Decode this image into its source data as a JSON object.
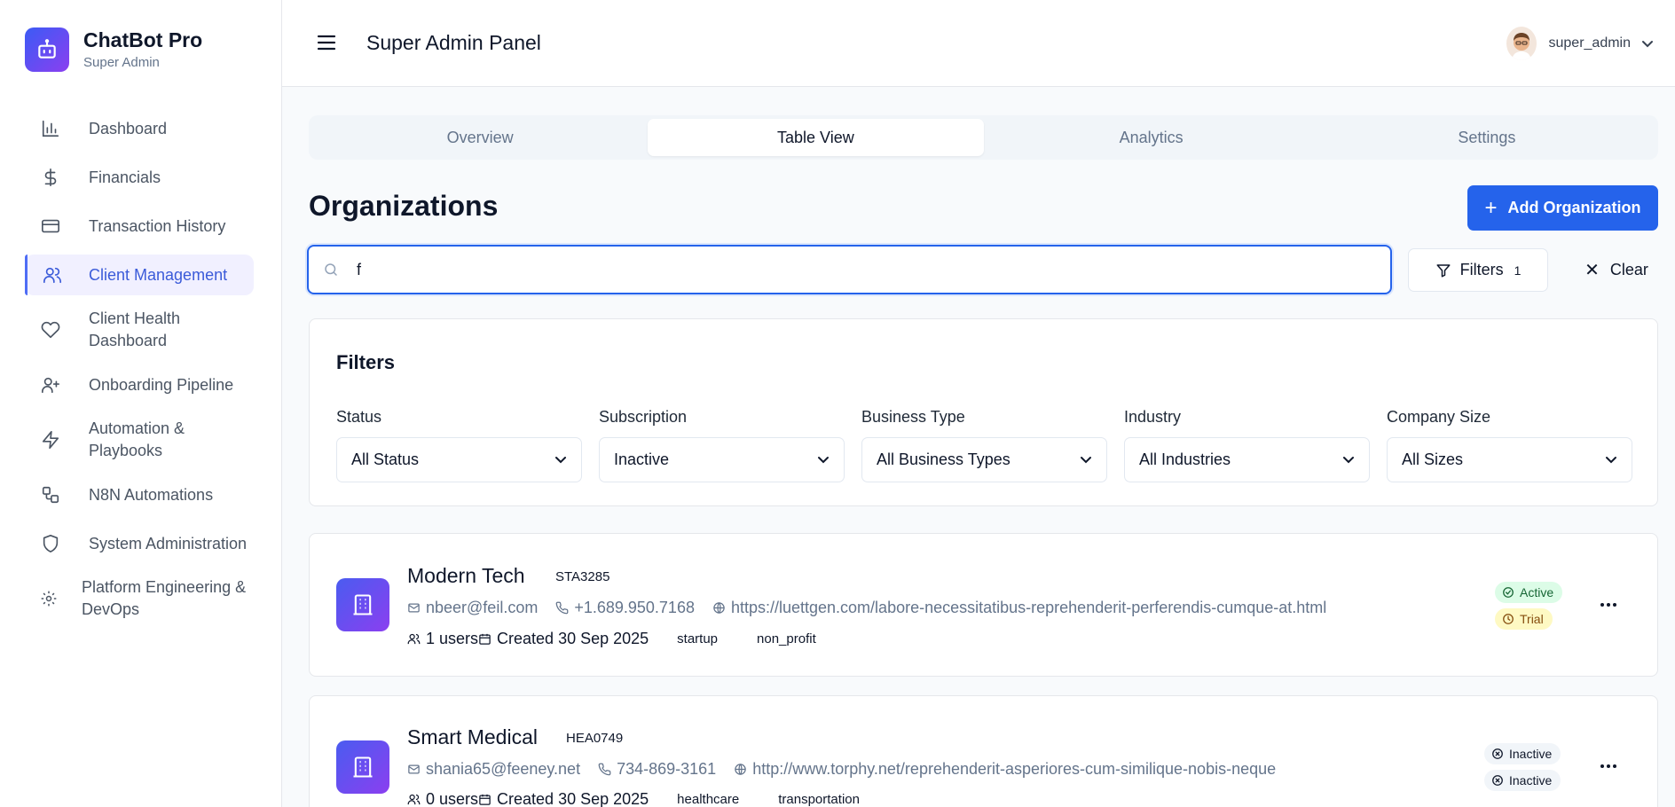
{
  "brand": {
    "name": "ChatBot Pro",
    "subtitle": "Super Admin"
  },
  "sidebar": {
    "items": [
      {
        "label": "Dashboard",
        "icon": "bar-chart-icon"
      },
      {
        "label": "Financials",
        "icon": "dollar-icon"
      },
      {
        "label": "Transaction History",
        "icon": "credit-card-icon"
      },
      {
        "label": "Client Management",
        "icon": "users-icon",
        "active": true
      },
      {
        "label": "Client Health Dashboard",
        "icon": "heart-icon"
      },
      {
        "label": "Onboarding Pipeline",
        "icon": "user-plus-icon"
      },
      {
        "label": "Automation & Playbooks",
        "icon": "lightning-icon"
      },
      {
        "label": "N8N Automations",
        "icon": "workflow-icon"
      },
      {
        "label": "System Administration",
        "icon": "shield-icon"
      },
      {
        "label": "Platform Engineering & DevOps",
        "icon": "gear-icon"
      }
    ]
  },
  "header": {
    "title": "Super Admin Panel",
    "username": "super_admin"
  },
  "tabs": [
    {
      "label": "Overview"
    },
    {
      "label": "Table View",
      "active": true
    },
    {
      "label": "Analytics"
    },
    {
      "label": "Settings"
    }
  ],
  "main": {
    "title": "Organizations",
    "add_button": "Add Organization",
    "search_value": "f",
    "filters_button": "Filters",
    "filters_count": "1",
    "clear_button": "Clear"
  },
  "filters": {
    "heading": "Filters",
    "groups": [
      {
        "label": "Status",
        "value": "All Status"
      },
      {
        "label": "Subscription",
        "value": "Inactive"
      },
      {
        "label": "Business Type",
        "value": "All Business Types"
      },
      {
        "label": "Industry",
        "value": "All Industries"
      },
      {
        "label": "Company Size",
        "value": "All Sizes"
      }
    ]
  },
  "organizations": [
    {
      "name": "Modern Tech",
      "code": "STA3285",
      "email": "nbeer@feil.com",
      "phone": "+1.689.950.7168",
      "website": "https://luettgen.com/labore-necessitatibus-reprehenderit-perferendis-cumque-at.html",
      "users": "1 users",
      "created": "Created 30 Sep 2025",
      "tags": [
        "startup",
        "non_profit"
      ],
      "badges": [
        "Active",
        "Trial"
      ]
    },
    {
      "name": "Smart Medical",
      "code": "HEA0749",
      "email": "shania65@feeney.net",
      "phone": "734-869-3161",
      "website": "http://www.torphy.net/reprehenderit-asperiores-cum-similique-nobis-neque",
      "users": "0 users",
      "created": "Created 30 Sep 2025",
      "tags": [
        "healthcare",
        "transportation"
      ],
      "badges": [
        "Inactive",
        "Inactive"
      ]
    }
  ],
  "colors": {
    "accent": "#2563eb",
    "active_nav_bg": "#f1f0ff",
    "badge_active_bg": "#dcfce7",
    "badge_trial_bg": "#fef9c3",
    "badge_inactive_bg": "#f1f5f9"
  }
}
